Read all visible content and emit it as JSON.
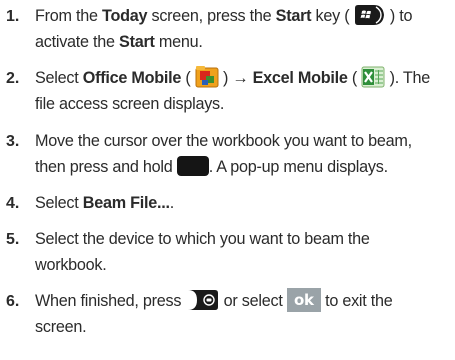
{
  "steps": [
    {
      "number": "1.",
      "line1": {
        "t1": "From the ",
        "b1": "Today",
        "t2": " screen, press the ",
        "b2": "Start",
        "t3": " key (",
        "t4": ") to"
      },
      "line2": {
        "t1": "activate the ",
        "b1": "Start",
        "t2": " menu."
      },
      "icon": "windows-start-key-icon"
    },
    {
      "number": "2.",
      "line1": {
        "t1": "Select ",
        "b1": "Office Mobile",
        "t2": " (",
        "t3": ") → ",
        "b2": "Excel Mobile",
        "t4": " (",
        "t5": "). The"
      },
      "line2": {
        "t1": "file access screen displays."
      },
      "icons": [
        "office-mobile-folder-icon",
        "excel-mobile-icon"
      ]
    },
    {
      "number": "3.",
      "line1": {
        "t1": "Move the cursor over the workbook you want to beam,"
      },
      "line2": {
        "t1": "then press and hold ",
        "t2": ". A pop-up menu displays."
      },
      "icon": "action-key-icon"
    },
    {
      "number": "4.",
      "line1": {
        "t1": "Select ",
        "b1": "Beam File...",
        "t2": "."
      }
    },
    {
      "number": "5.",
      "line1": {
        "t1": "Select the device to which you want to beam the"
      },
      "line2": {
        "t1": "workbook."
      }
    },
    {
      "number": "6.",
      "line1": {
        "t1": "When finished, press ",
        "t2": " or select ",
        "t3": " to exit the"
      },
      "line2": {
        "t1": "screen."
      },
      "ok_label": "ok",
      "icon": "end-key-icon"
    }
  ],
  "colors": {
    "text": "#2b2b2b",
    "ok_button": "#9aa3a8",
    "key_black": "#151515"
  }
}
